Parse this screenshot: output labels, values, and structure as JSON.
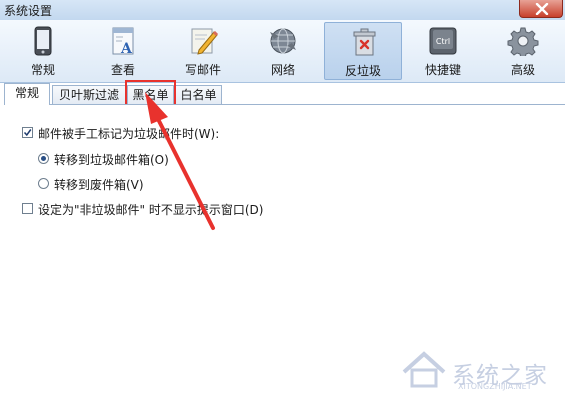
{
  "window": {
    "title": "系统设置"
  },
  "toolbar": {
    "items": [
      {
        "label": "常规",
        "icon": "phone-icon"
      },
      {
        "label": "查看",
        "icon": "view-document-icon"
      },
      {
        "label": "写邮件",
        "icon": "compose-pencil-icon"
      },
      {
        "label": "网络",
        "icon": "network-globe-icon"
      },
      {
        "label": "反垃圾",
        "icon": "antispam-icon",
        "active": true
      },
      {
        "label": "快捷键",
        "icon": "ctrl-key-icon",
        "key_text": "Ctrl"
      },
      {
        "label": "高级",
        "icon": "gear-icon"
      }
    ]
  },
  "tabs": [
    {
      "label": "常规",
      "active": true
    },
    {
      "label": "贝叶斯过滤"
    },
    {
      "label": "黑名单",
      "highlighted": true
    },
    {
      "label": "白名单"
    }
  ],
  "options": {
    "mark_spam": {
      "label": "邮件被手工标记为垃圾邮件时(W):",
      "checked": true
    },
    "move_spam": {
      "label": "转移到垃圾邮件箱(O)",
      "selected": true
    },
    "move_trash": {
      "label": "转移到废件箱(V)",
      "selected": false
    },
    "no_prompt": {
      "label": "设定为\"非垃圾邮件\" 时不显示提示窗口(D)",
      "checked": false
    }
  },
  "watermark": {
    "text": "系统之家",
    "sub": "XITONGZHIJIA.NET"
  },
  "colors": {
    "annotation": "#e8322d",
    "toolbar_active": "#b9d1ec",
    "close_button": "#c7402c"
  }
}
